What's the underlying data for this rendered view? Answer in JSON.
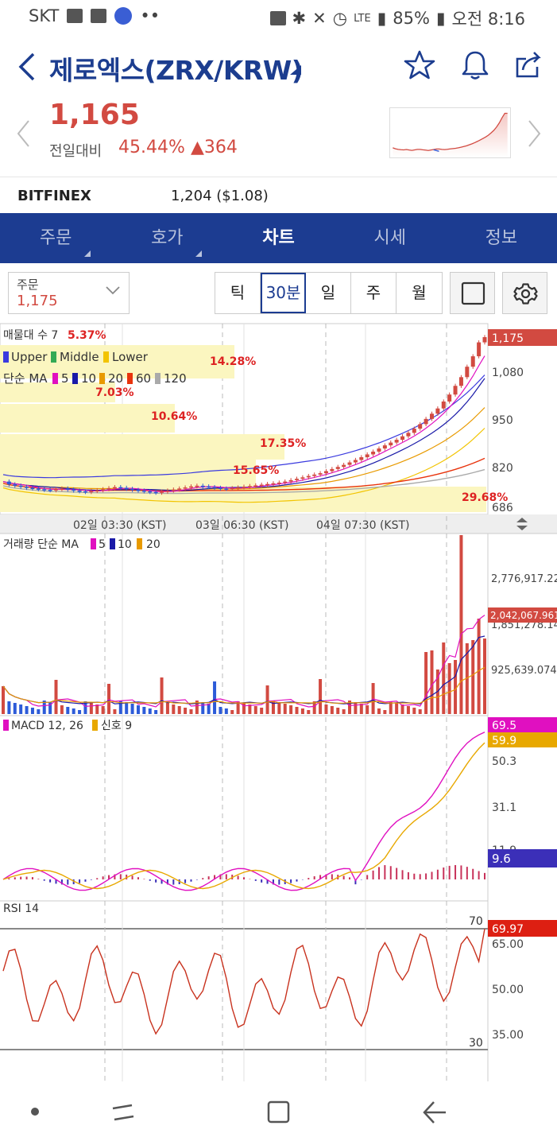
{
  "status_bar": {
    "carrier": "SKT",
    "battery": "85%",
    "time": "오전 8:16",
    "network": "LTE"
  },
  "header": {
    "title": "제로엑스(ZRX/KRW)"
  },
  "price": {
    "current": "1,165",
    "prev_label": "전일대비",
    "change_pct": "45.44%",
    "change_abs": "▲364"
  },
  "exchange": {
    "name": "BITFINEX",
    "value": "1,204 ($1.08)"
  },
  "tabs": [
    {
      "label": "주문",
      "active": false
    },
    {
      "label": "호가",
      "active": false
    },
    {
      "label": "차트",
      "active": true
    },
    {
      "label": "시세",
      "active": false
    },
    {
      "label": "정보",
      "active": false
    }
  ],
  "order_select": {
    "label": "주문",
    "value": "1,175"
  },
  "periods": [
    "틱",
    "30분",
    "일",
    "주",
    "월"
  ],
  "active_period": "30분",
  "chart_data": {
    "type": "line",
    "price_panel": {
      "legend_volume": "매물대 수 7",
      "legend_volume_pct": "5.37%",
      "legend_bb": [
        "Upper",
        "Middle",
        "Lower"
      ],
      "legend_ma_title": "단순 MA",
      "legend_ma": [
        "5",
        "10",
        "20",
        "60",
        "120"
      ],
      "volume_profile_pcts": [
        "5.37%",
        "14.28%",
        "7.03%",
        "10.64%",
        "17.35%",
        "15.65%",
        "29.68%"
      ],
      "y_ticks": [
        "1,080",
        "950",
        "820",
        "686"
      ],
      "last_price_badge": "1,175",
      "x_labels": [
        "02일 03:30 (KST)",
        "03일 06:30 (KST)",
        "04일 07:30 (KST)"
      ],
      "close": [
        760,
        752,
        748,
        745,
        742,
        740,
        738,
        736,
        735,
        738,
        740,
        737,
        734,
        732,
        730,
        733,
        735,
        738,
        741,
        744,
        742,
        739,
        736,
        734,
        732,
        730,
        728,
        731,
        734,
        737,
        740,
        743,
        746,
        748,
        746,
        744,
        742,
        740,
        739,
        741,
        743,
        745,
        747,
        749,
        751,
        753,
        755,
        757,
        760,
        764,
        768,
        772,
        776,
        780,
        784,
        790,
        796,
        802,
        808,
        815,
        822,
        830,
        838,
        846,
        855,
        864,
        872,
        880,
        890,
        900,
        912,
        925,
        940,
        955,
        970,
        990,
        1010,
        1035,
        1060,
        1090,
        1120,
        1160,
        1175
      ]
    },
    "volume_panel": {
      "legend": "거래량 단순 MA",
      "legend_ma": [
        "5",
        "10",
        "20"
      ],
      "y_ticks": [
        "2,776,917.222",
        "1,851,278.148",
        "925,639.074"
      ],
      "last_badge": "2,042,067.961"
    },
    "macd_panel": {
      "legend": "MACD 12, 26",
      "signal_legend": "신호 9",
      "y_ticks": [
        "50.3",
        "31.1",
        "11.9"
      ],
      "badges": [
        "69.5",
        "59.9",
        "9.6"
      ]
    },
    "rsi_panel": {
      "legend": "RSI 14",
      "y_ticks": [
        "65.00",
        "50.00",
        "35.00"
      ],
      "levels": [
        "70",
        "30"
      ],
      "last_badge": "69.97"
    }
  },
  "colors": {
    "brand_blue": "#1c3c91",
    "up_red": "#d24a41"
  }
}
